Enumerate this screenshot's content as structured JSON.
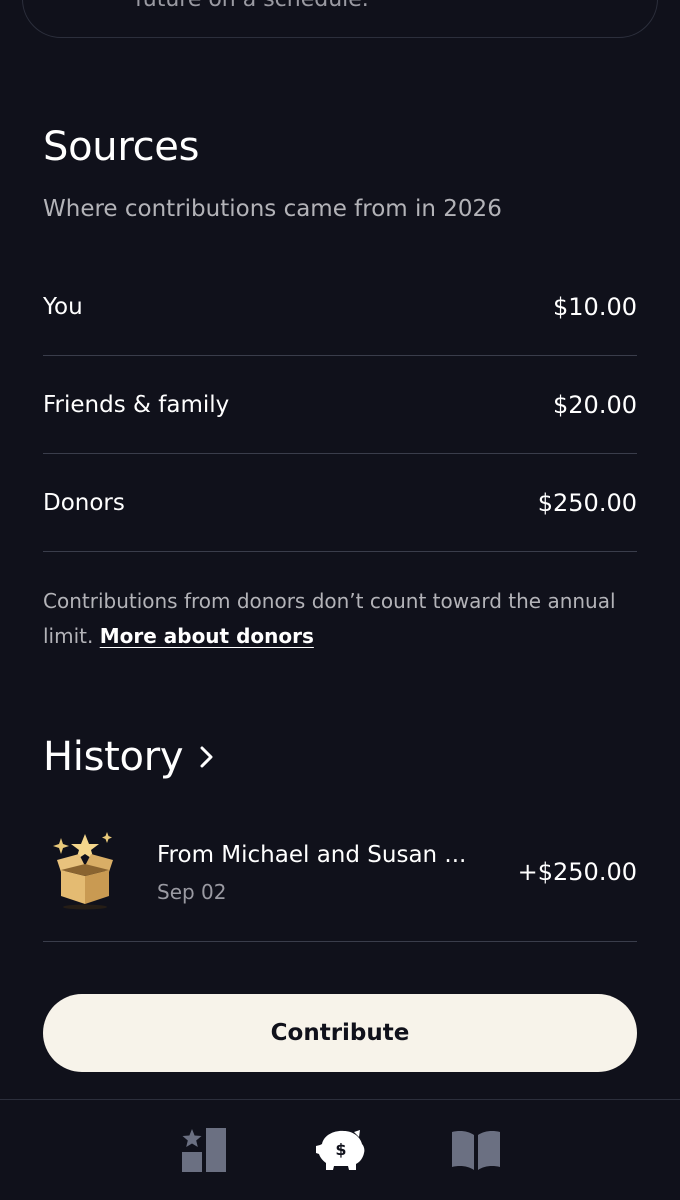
{
  "top_card": {
    "text": "future on a schedule."
  },
  "sources": {
    "title": "Sources",
    "subtitle": "Where contributions came from in 2026",
    "rows": [
      {
        "label": "You",
        "amount": "$10.00"
      },
      {
        "label": "Friends & family",
        "amount": "$20.00"
      },
      {
        "label": "Donors",
        "amount": "$250.00"
      }
    ],
    "note": "Contributions from donors don’t count toward the annual limit.",
    "note_link": "More about donors"
  },
  "history": {
    "title": "History",
    "items": [
      {
        "icon": "gift-box-icon",
        "name": "From Michael and Susan ...",
        "date": "Sep 02",
        "amount": "+$250.00"
      }
    ]
  },
  "actions": {
    "contribute_label": "Contribute"
  },
  "nav": {
    "items": [
      {
        "icon": "goals-icon",
        "active": false
      },
      {
        "icon": "piggy-bank-icon",
        "active": true
      },
      {
        "icon": "book-icon",
        "active": false
      }
    ]
  },
  "colors": {
    "background": "#10111b",
    "divider": "#3a3d4b",
    "button": "#f7f3ea",
    "muted_text": "#b3b3b8",
    "inactive_nav": "#6b7082"
  }
}
